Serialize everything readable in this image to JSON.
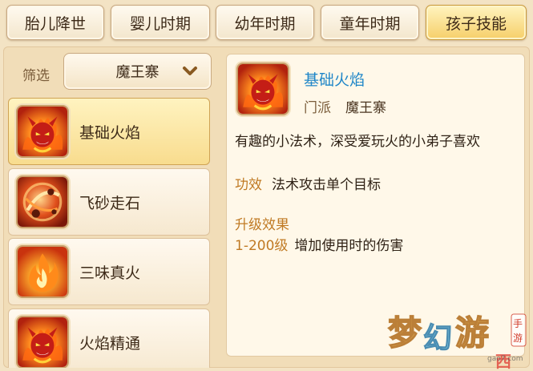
{
  "tabs": [
    {
      "label": "胎儿降世",
      "active": false
    },
    {
      "label": "婴儿时期",
      "active": false
    },
    {
      "label": "幼年时期",
      "active": false
    },
    {
      "label": "童年时期",
      "active": false
    },
    {
      "label": "孩子技能",
      "active": true
    }
  ],
  "filter": {
    "label": "筛选",
    "selected": "魔王寨"
  },
  "skills": [
    {
      "name": "基础火焰",
      "icon": "demon-fire-icon",
      "selected": true
    },
    {
      "name": "飞砂走石",
      "icon": "fire-rock-icon",
      "selected": false
    },
    {
      "name": "三味真火",
      "icon": "flame-icon",
      "selected": false
    },
    {
      "name": "火焰精通",
      "icon": "demon-fire-icon",
      "selected": false
    }
  ],
  "detail": {
    "title": "基础火焰",
    "school_label": "门派",
    "school_value": "魔王寨",
    "description": "有趣的小法术，深受爱玩火的小弟子喜欢",
    "effect_label": "功效",
    "effect_value": "法术攻击单个目标",
    "upgrade_title": "升级效果",
    "upgrade_range": "1-200级",
    "upgrade_value": "增加使用时的伤害"
  },
  "watermark": {
    "text": "梦幻西游",
    "sub": "手游",
    "site": "gao7.com"
  },
  "colors": {
    "active_tab": "#f6cf6a",
    "title_blue": "#1f86c8",
    "label_orange": "#c07a24"
  }
}
